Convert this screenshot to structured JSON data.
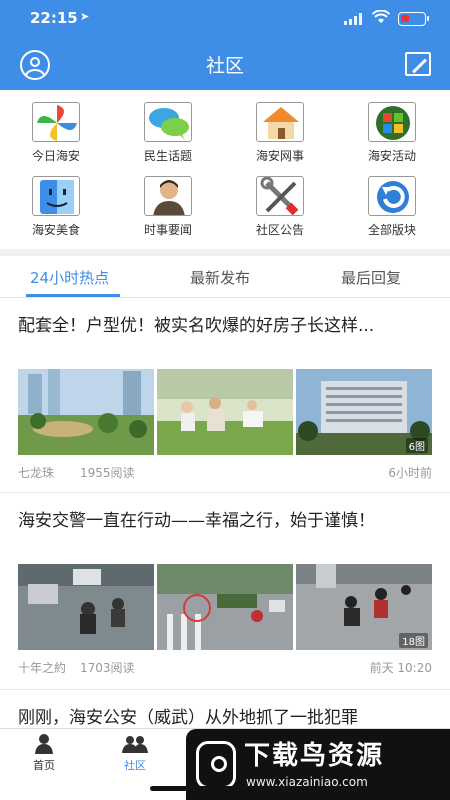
{
  "status_bar": {
    "time": "22:15"
  },
  "navbar": {
    "title": "社区"
  },
  "grid": [
    {
      "label": "今日海安",
      "icon": "pinwheel-icon"
    },
    {
      "label": "民生话题",
      "icon": "chat-bubbles-icon"
    },
    {
      "label": "海安网事",
      "icon": "house-icon"
    },
    {
      "label": "海安活动",
      "icon": "windows-logo-icon"
    },
    {
      "label": "海安美食",
      "icon": "finder-face-icon"
    },
    {
      "label": "时事要闻",
      "icon": "person-icon"
    },
    {
      "label": "社区公告",
      "icon": "tools-icon"
    },
    {
      "label": "全部版块",
      "icon": "refresh-arrow-icon"
    }
  ],
  "tabs": [
    "24小时热点",
    "最新发布",
    "最后回复"
  ],
  "posts": [
    {
      "title": "配套全！户型优！被实名吹爆的好房子长这样...",
      "image_count": "6图",
      "author": "七龙珠",
      "reads": "1955阅读",
      "time": "6小时前"
    },
    {
      "title": "海安交警一直在行动——幸福之行，始于谨慎！",
      "image_count": "18图",
      "author": "十年之約",
      "reads": "1703阅读",
      "time": "前天 10:20"
    },
    {
      "title": "刚刚，海安公安（威武）从外地抓了一批犯罪"
    }
  ],
  "tabbar": [
    {
      "label": "首页",
      "icon": "home-person-icon"
    },
    {
      "label": "社区",
      "icon": "community-people-icon"
    }
  ],
  "watermark": {
    "title": "下载鸟资源",
    "url": "www.xiazainiao.com"
  },
  "colors": {
    "primary": "#3e8ee8",
    "text": "#222222",
    "muted": "#999999"
  }
}
